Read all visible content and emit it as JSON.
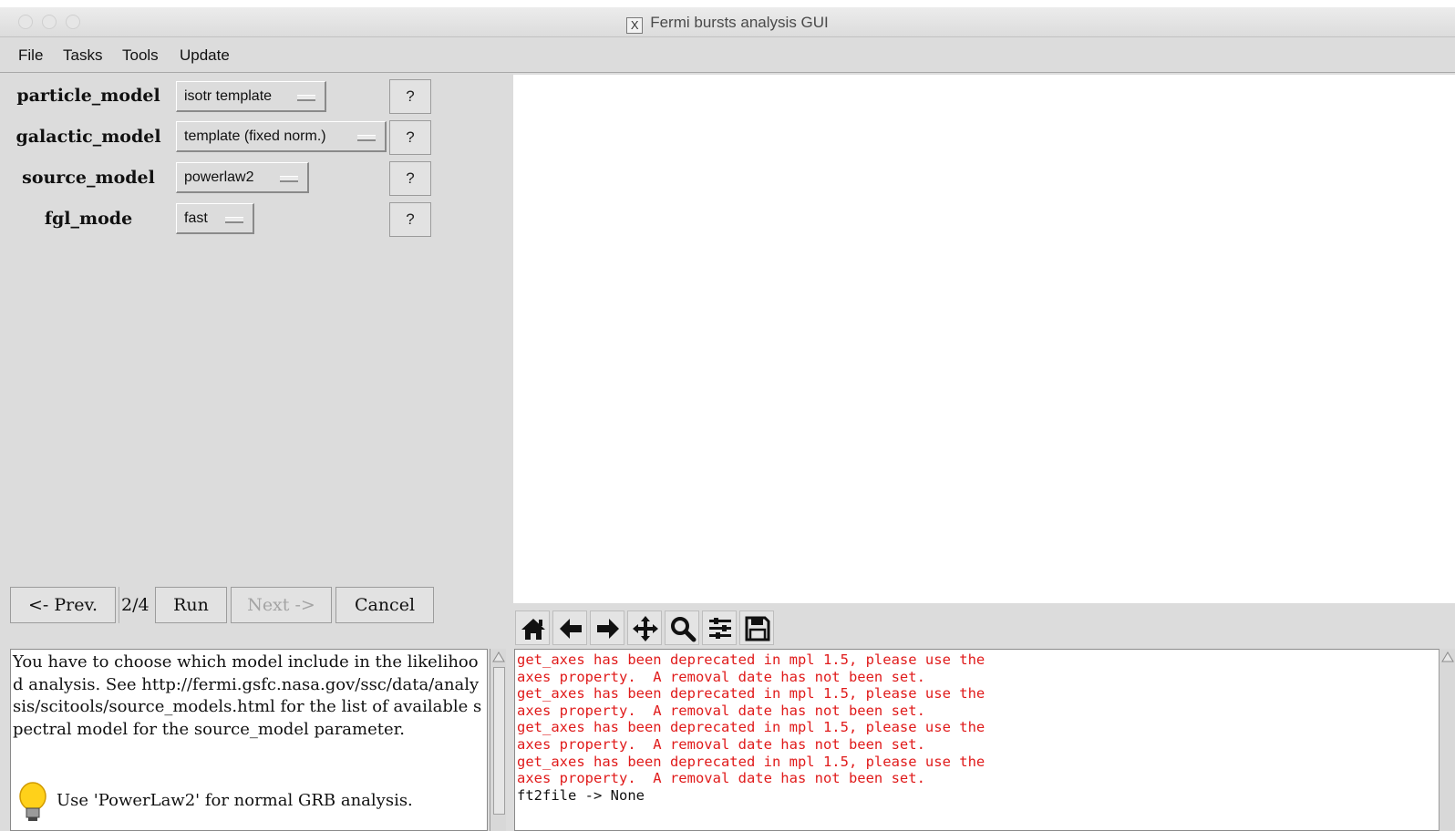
{
  "window": {
    "title": "Fermi bursts analysis GUI",
    "title_icon": "x11-icon"
  },
  "menu": [
    "File",
    "Tasks",
    "Tools",
    "Update"
  ],
  "params": [
    {
      "label": "particle_model",
      "value": "isotr template"
    },
    {
      "label": "galactic_model",
      "value": "template (fixed norm.)"
    },
    {
      "label": "source_model",
      "value": "powerlaw2"
    },
    {
      "label": "fgl_mode",
      "value": "fast"
    }
  ],
  "help_label": "?",
  "nav": {
    "prev": "<- Prev.",
    "counter": "2/4",
    "run": "Run",
    "next": "Next ->",
    "cancel": "Cancel"
  },
  "toolbar": [
    "home-icon",
    "back-arrow-icon",
    "forward-arrow-icon",
    "pan-icon",
    "zoom-icon",
    "subplots-icon",
    "save-icon"
  ],
  "help_text": {
    "paragraph": "You have to choose which model include in the likelihood analysis. See http://fermi.gsfc.nasa.gov/ssc/data/analysis/scitools/source_models.html for the list of available spectral model for the source_model parameter.",
    "tip": "Use 'PowerLaw2' for normal GRB analysis."
  },
  "console": [
    {
      "text": "get_axes has been deprecated in mpl 1.5, please use the",
      "kind": "err"
    },
    {
      "text": "axes property.  A removal date has not been set.",
      "kind": "err"
    },
    {
      "text": "get_axes has been deprecated in mpl 1.5, please use the",
      "kind": "err"
    },
    {
      "text": "axes property.  A removal date has not been set.",
      "kind": "err"
    },
    {
      "text": "get_axes has been deprecated in mpl 1.5, please use the",
      "kind": "err"
    },
    {
      "text": "axes property.  A removal date has not been set.",
      "kind": "err"
    },
    {
      "text": "get_axes has been deprecated in mpl 1.5, please use the",
      "kind": "err"
    },
    {
      "text": "axes property.  A removal date has not been set.",
      "kind": "err"
    },
    {
      "text": "ft2file -> None",
      "kind": "out"
    }
  ],
  "colors": {
    "error_text": "#e01b1b",
    "window_bg": "#dcdcdc",
    "disabled_text": "#a4a4a4"
  }
}
